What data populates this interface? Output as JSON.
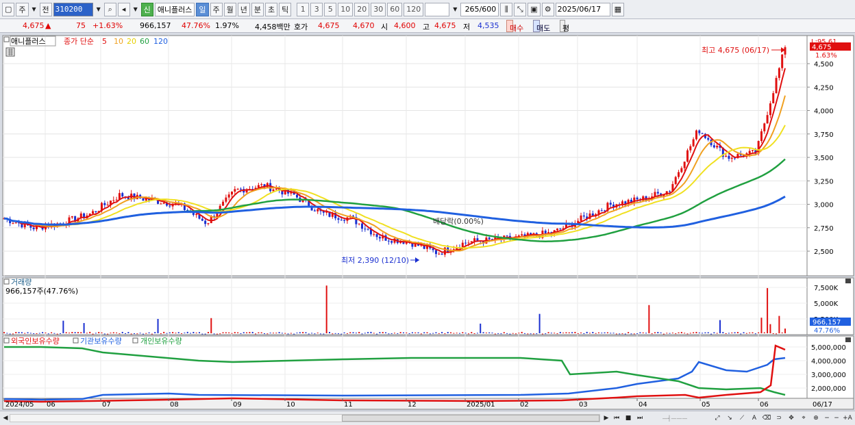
{
  "toolbar": {
    "period_sel": "주",
    "prev_label": "전",
    "code": "310200",
    "tag_new": "신",
    "stock_name": "애니플러스",
    "periods": [
      "일",
      "주",
      "월",
      "년",
      "분",
      "초",
      "틱"
    ],
    "active_period": "일",
    "minute_opts": [
      "1",
      "3",
      "5",
      "10",
      "20",
      "30",
      "60",
      "120"
    ],
    "count": "265",
    "count_total": "/600",
    "date": "2025/06/17"
  },
  "info": {
    "price": "4,675",
    "arrow": "▲",
    "change": "75",
    "change_pct": "+1.63%",
    "volume": "966,157",
    "vol_ratio": "47.76%",
    "turnover": "1.97%",
    "amount": "4,458백만",
    "quote_label": "호가",
    "ask": "4,675",
    "bid": "4,670",
    "open_label": "시",
    "open": "4,600",
    "high_label": "고",
    "high": "4,675",
    "low_label": "저",
    "low": "4,535",
    "buy": "매수",
    "sell": "매도",
    "eval": "평"
  },
  "price_panel": {
    "legend_name": "애니플러스",
    "legend_ma": "종가 단순",
    "ma_periods": [
      "5",
      "10",
      "20",
      "60",
      "120"
    ],
    "ma_colors": [
      "#e01010",
      "#f0a020",
      "#f0e020",
      "#20a040",
      "#2060e0"
    ],
    "y_ticks": [
      "4,500",
      "4,250",
      "4,000",
      "3,750",
      "3,500",
      "3,250",
      "3,000",
      "2,750",
      "2,500"
    ],
    "y_values": [
      4500,
      4250,
      4000,
      3750,
      3500,
      3250,
      3000,
      2750,
      2500
    ],
    "right_top_label": "L:95.61",
    "current_tag": "4,675",
    "current_pct": "1.63%",
    "high_annotation": "최고 4,675 (06/17)",
    "low_annotation": "최저 2,390 (12/10)",
    "dividend_annotation": "배당락(0.00%)"
  },
  "volume_panel": {
    "title": "거래량",
    "subtitle": "966,157주(47.76%)",
    "y_ticks": [
      "7,500K",
      "5,000K",
      "2,500K"
    ],
    "current_tag": "966,157",
    "current_pct": "47.76%"
  },
  "holding_panel": {
    "legend": [
      "외국인보유수량",
      "기관보유수량",
      "개인보유수량"
    ],
    "legend_colors": [
      "#e01010",
      "#2060e0",
      "#20a040"
    ],
    "y_ticks": [
      "5,000,000",
      "4,000,000",
      "3,000,000",
      "2,000,000"
    ]
  },
  "x_axis": {
    "labels": [
      "2024/05",
      "06",
      "07",
      "08",
      "09",
      "10",
      "11",
      "12",
      "2025/01",
      "02",
      "03",
      "04",
      "05",
      "06"
    ],
    "right_label": "06/17"
  },
  "chart_data": {
    "type": "line",
    "series": [
      {
        "name": "애니플러스",
        "values": [
          2850,
          2750,
          2800,
          2900,
          3100,
          3050,
          3000,
          2800,
          3150,
          3200,
          3100,
          2900,
          2850,
          2650,
          2600,
          2480,
          2600,
          2620,
          2650,
          2700,
          2850,
          3000,
          3050,
          3150,
          3800,
          3500,
          3550,
          4675
        ]
      }
    ],
    "price_high": 4675,
    "price_low": 2390
  }
}
